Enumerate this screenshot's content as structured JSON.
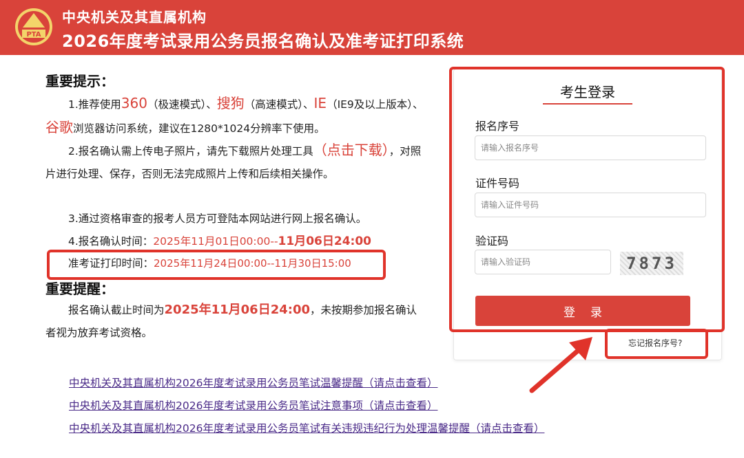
{
  "header": {
    "logo_text": "PTA",
    "org": "中央机关及其直属机构",
    "title": "2026年度考试录用公务员报名确认及准考证打印系统"
  },
  "notice": {
    "title": "重要提示：",
    "item1": {
      "prefix": "1.推荐使用",
      "browser1": "360",
      "mode1": "（极速模式）、",
      "browser2": "搜狗",
      "mode2": "（高速模式）、",
      "browser3": "IE",
      "mode3": "（IE9及以上版本）、",
      "browser4": "谷歌",
      "suffix": "浏览器访问系统，建议在1280*1024分辨率下使用。"
    },
    "item2": {
      "prefix": "2.报名确认需上传电子照片，请先下载照片处理工具",
      "link": "（点击下载）",
      "suffix": "，对照片进行处理、保存，否则无法完成照片上传和后续相关操作。"
    },
    "item3": "3.通过资格审查的报考人员方可登陆本网站进行网上报名确认。",
    "item4": {
      "label": "4.报名确认时间：",
      "start": "2025年11月01日00:00--",
      "end": "11月06日24:00"
    },
    "item5": {
      "label": "准考证打印时间：",
      "value": "2025年11月24日00:00--11月30日15:00"
    }
  },
  "reminder": {
    "title": "重要提醒：",
    "prefix": "报名确认截止时间为",
    "deadline": "2025年11月06日24:00",
    "suffix": "，未按期参加报名确认者视为放弃考试资格。"
  },
  "login": {
    "heading": "考生登录",
    "reg_label": "报名序号",
    "reg_placeholder": "请输入报名序号",
    "id_label": "证件号码",
    "id_placeholder": "请输入证件号码",
    "captcha_label": "验证码",
    "captcha_placeholder": "请输入验证码",
    "captcha_text": "7873",
    "button": "登录",
    "forgot": "忘记报名序号?"
  },
  "links": [
    "中央机关及其直属机构2026年度考试录用公务员笔试温馨提醒（请点击查看）",
    "中央机关及其直属机构2026年度考试录用公务员笔试注意事项（请点击查看）",
    "中央机关及其直属机构2026年度考试录用公务员笔试有关违规违纪行为处理温馨提醒（请点击查看）"
  ],
  "colors": {
    "brand": "#d9433a",
    "highlight": "#e0332a",
    "link": "#4a2a88"
  }
}
